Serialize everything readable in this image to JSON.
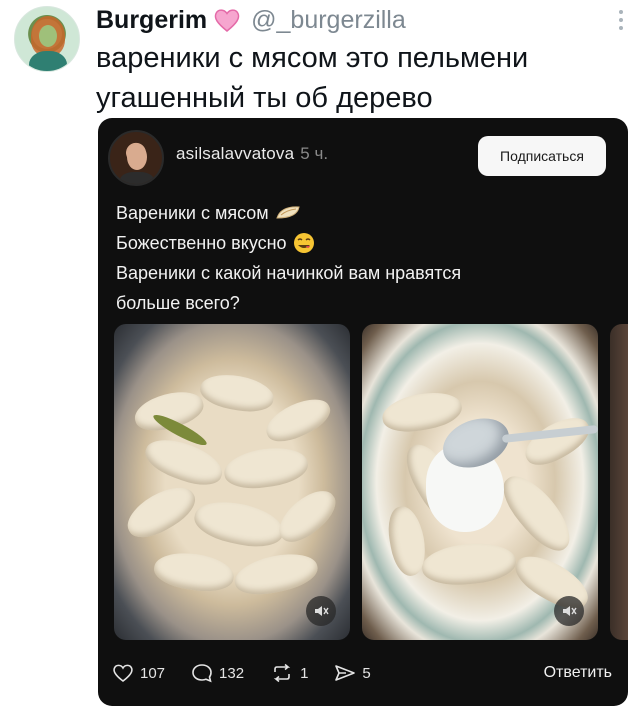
{
  "tweet": {
    "display_name": "Burgerim",
    "handle": "@_burgerzilla",
    "text_lines": [
      "вареники с мясом это пельмени",
      "угашенный ты об дерево"
    ],
    "icons": [
      "heart-emoji-icon",
      "more-options-icon"
    ]
  },
  "embedded_post": {
    "username": "asilsalavvatova",
    "time": "5 ч.",
    "subscribe_label": "Подписаться",
    "lines": [
      "Вареники с мясом",
      "Божественно вкусно",
      "Вареники с какой начинкой вам нравятся",
      "больше всего?"
    ],
    "actions": {
      "likes": "107",
      "comments": "132",
      "reposts": "1",
      "shares": "5",
      "reply_label": "Ответить"
    }
  }
}
